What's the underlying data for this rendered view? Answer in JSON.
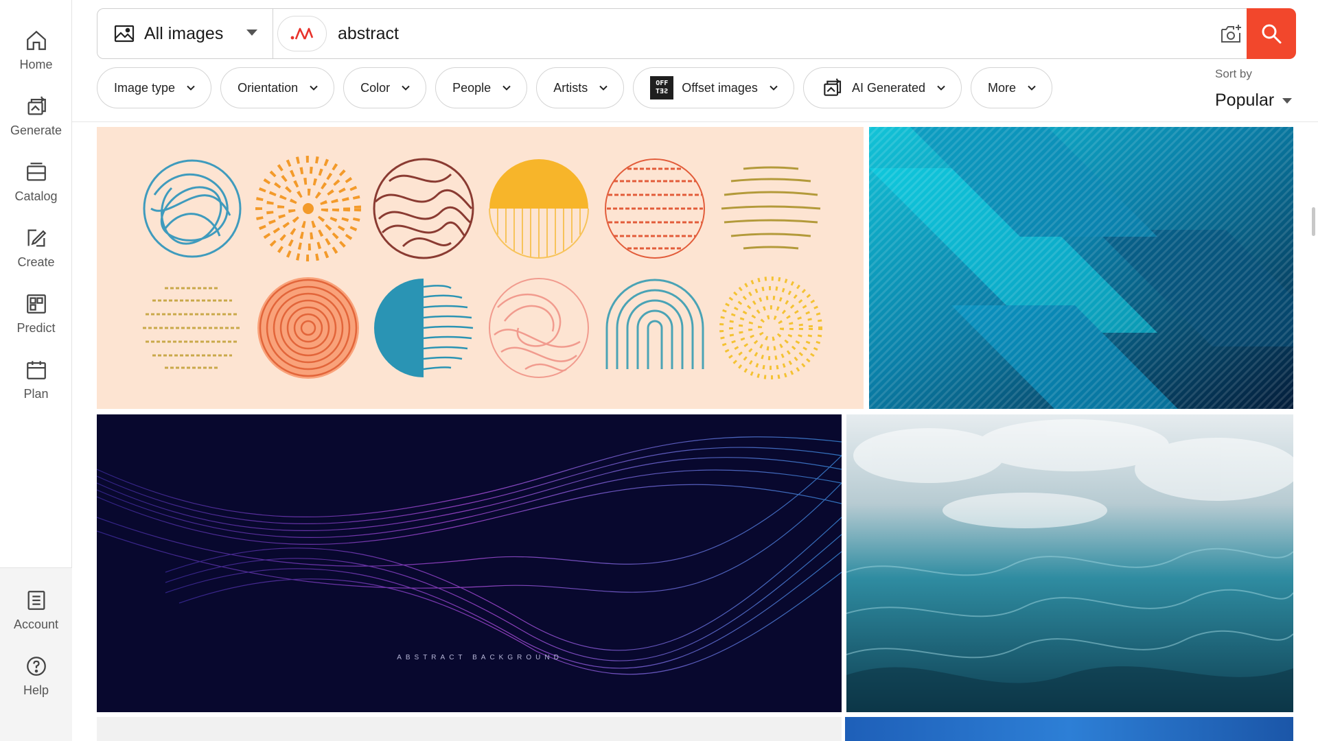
{
  "sidebar": {
    "items": [
      {
        "label": "Home",
        "icon": "home-icon"
      },
      {
        "label": "Generate",
        "icon": "generate-icon"
      },
      {
        "label": "Catalog",
        "icon": "catalog-icon"
      },
      {
        "label": "Create",
        "icon": "create-icon"
      },
      {
        "label": "Predict",
        "icon": "predict-icon"
      },
      {
        "label": "Plan",
        "icon": "plan-icon"
      }
    ],
    "bottom_items": [
      {
        "label": "Account",
        "icon": "account-icon"
      },
      {
        "label": "Help",
        "icon": "help-icon"
      }
    ]
  },
  "search": {
    "type_selected": "All images",
    "query": "abstract",
    "ai_toggle_icon": "ai-search-icon",
    "camera_icon": "camera-search-icon",
    "search_icon": "search-icon",
    "accent_color": "#f2472c"
  },
  "filters": [
    {
      "label": "Image type"
    },
    {
      "label": "Orientation"
    },
    {
      "label": "Color"
    },
    {
      "label": "People"
    },
    {
      "label": "Artists"
    },
    {
      "label": "Offset images",
      "badge": [
        "OFF",
        "SET"
      ]
    },
    {
      "label": "AI Generated",
      "icon": "ai-generated-icon"
    },
    {
      "label": "More"
    }
  ],
  "sort": {
    "label": "Sort by",
    "value": "Popular"
  },
  "results": {
    "images": [
      {
        "name": "hand-drawn-circle-textures",
        "background": "#fde4d2"
      },
      {
        "name": "blue-diagonal-stripes",
        "background": "#0a6a8a"
      },
      {
        "name": "purple-wave-lines",
        "background": "#0a0a33",
        "caption": "ABSTRACT BACKGROUND"
      },
      {
        "name": "ocean-water-texture",
        "background": "#1d6d82"
      }
    ]
  }
}
